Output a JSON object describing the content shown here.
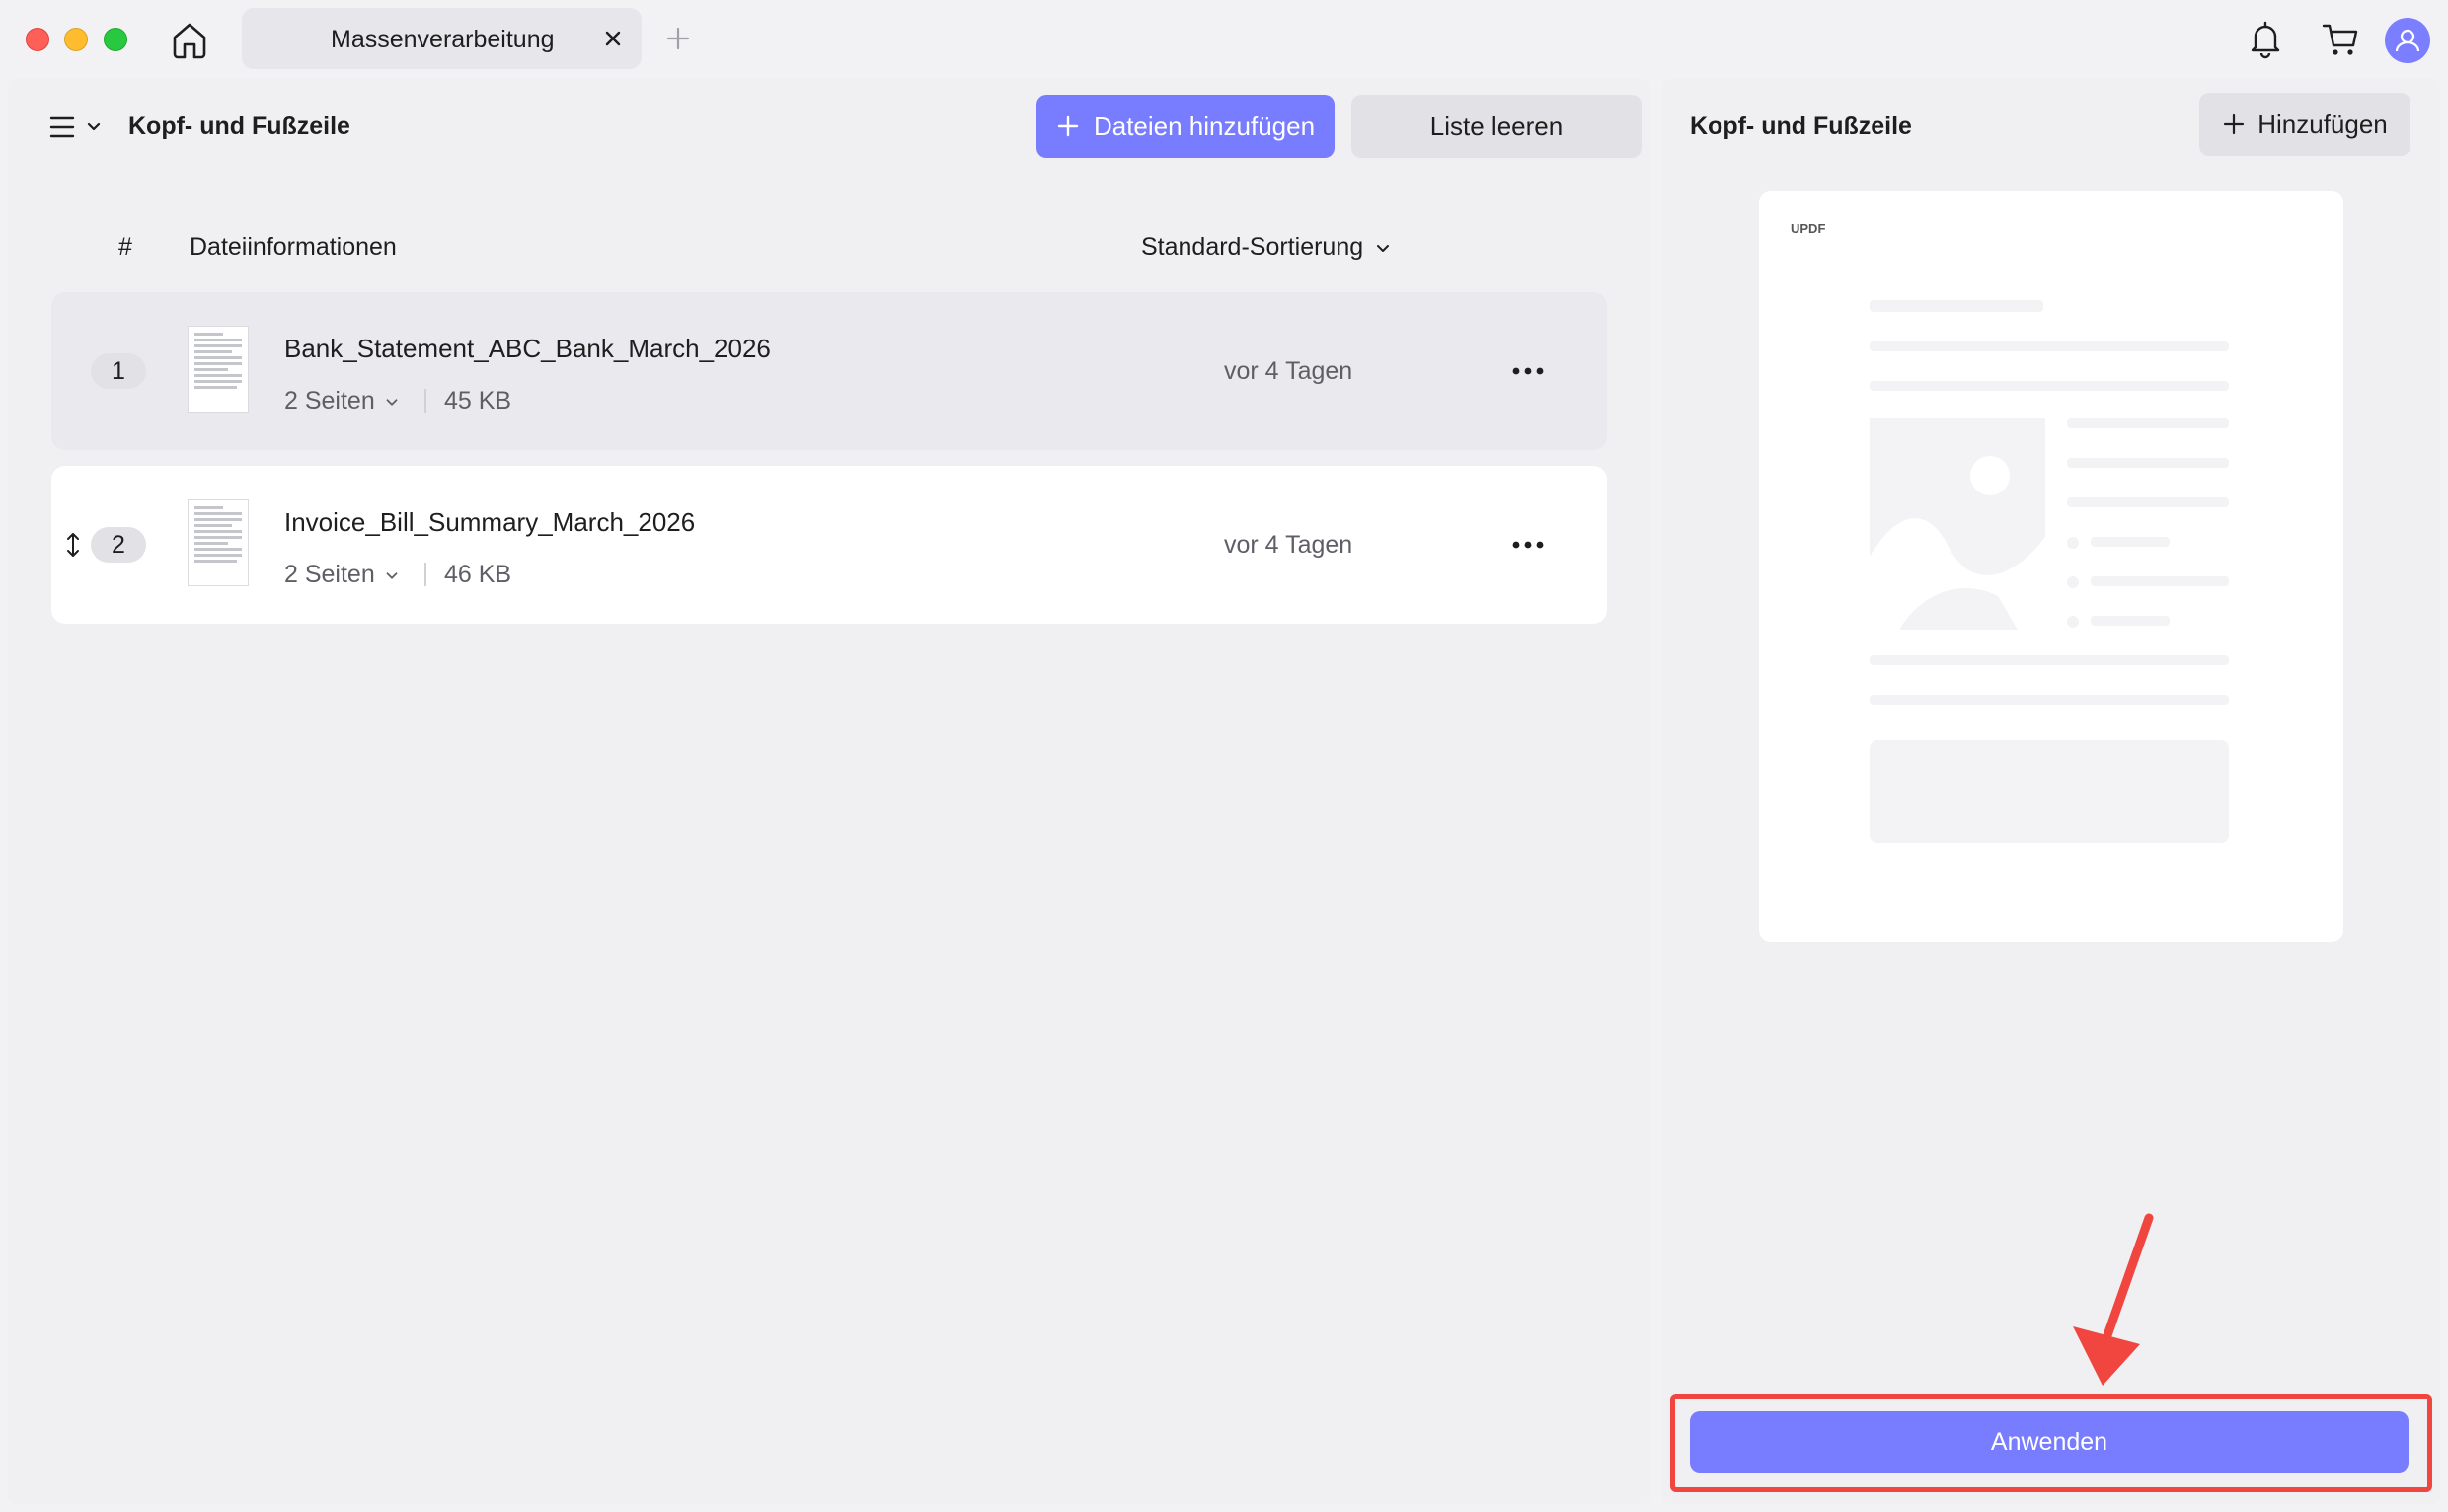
{
  "tab": {
    "label": "Massenverarbeitung"
  },
  "toolbar": {
    "title": "Kopf- und Fußzeile",
    "add_files": "Dateien hinzufügen",
    "clear_list": "Liste leeren"
  },
  "list_header": {
    "number": "#",
    "info": "Dateiinformationen",
    "sort": "Standard-Sortierung"
  },
  "files": [
    {
      "index": "1",
      "name": "Bank_Statement_ABC_Bank_March_2026",
      "pages": "2 Seiten",
      "size": "45 KB",
      "date": "vor 4 Tagen"
    },
    {
      "index": "2",
      "name": "Invoice_Bill_Summary_March_2026",
      "pages": "2 Seiten",
      "size": "46 KB",
      "date": "vor 4 Tagen"
    }
  ],
  "right_panel": {
    "title": "Kopf- und Fußzeile",
    "add": "Hinzufügen",
    "preview_logo": "UPDF",
    "apply": "Anwenden"
  },
  "colors": {
    "accent": "#787cff",
    "highlight": "#f0463f"
  }
}
